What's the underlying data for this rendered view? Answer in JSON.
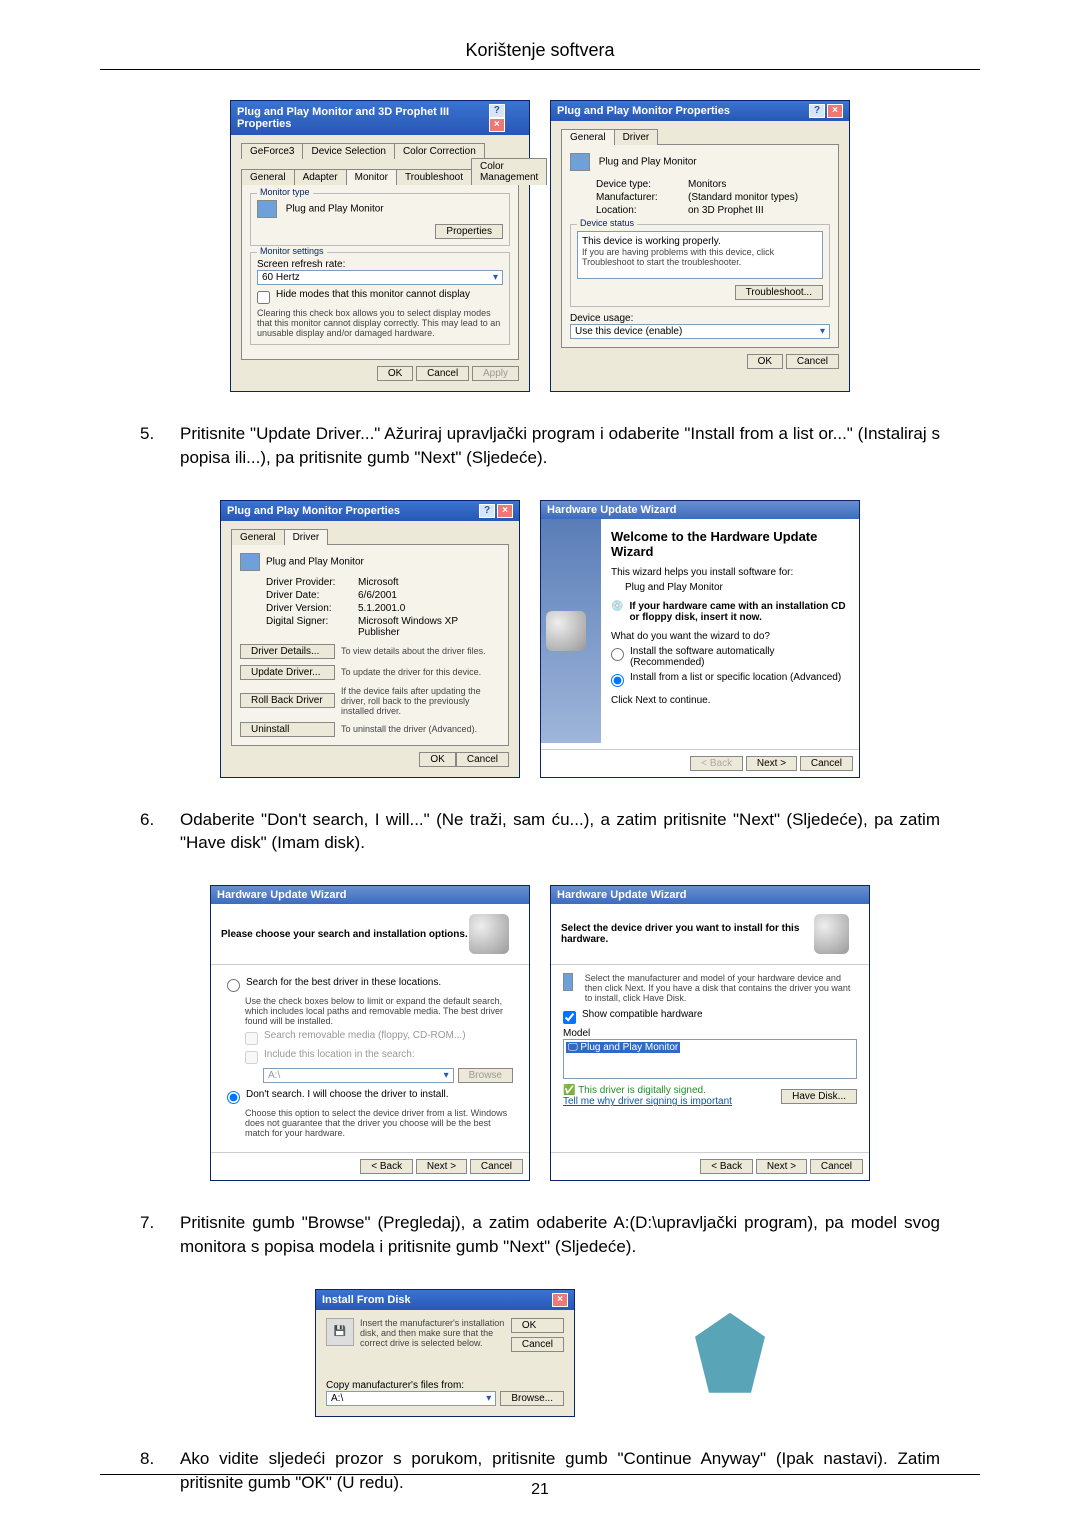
{
  "header_title": "Korištenje softvera",
  "page_number": "21",
  "step5": "Pritisnite \"Update Driver...\" Ažuriraj upravljački program i odaberite \"Install from a list or...\" (Instaliraj s popisa ili...), pa pritisnite gumb \"Next\" (Sljedeće).",
  "step6": "Odaberite \"Don't search, I will...\" (Ne traži, sam ću...), a zatim pritisnite \"Next\" (Sljedeće), pa zatim \"Have disk\" (Imam disk).",
  "step7": "Pritisnite gumb \"Browse\" (Pregledaj), a zatim odaberite A:(D:\\upravljački program), pa model svog monitora s popisa modela i pritisnite gumb \"Next\" (Sljedeće).",
  "step8": "Ako vidite sljedeći prozor s porukom, pritisnite gumb \"Continue Anyway\" (Ipak nastavi). Zatim pritisnite gumb \"OK\" (U redu).",
  "dlg1": {
    "title": "Plug and Play Monitor and 3D Prophet III Properties",
    "tabs": [
      "GeForce3",
      "Device Selection",
      "Color Correction",
      "General",
      "Adapter",
      "Monitor",
      "Troubleshoot",
      "Color Management"
    ],
    "montype_label": "Monitor type",
    "montype_value": "Plug and Play Monitor",
    "properties_btn": "Properties",
    "monset_label": "Monitor settings",
    "refresh_label": "Screen refresh rate:",
    "refresh_value": "60 Hertz",
    "hide_chk": "Hide modes that this monitor cannot display",
    "hide_note": "Clearing this check box allows you to select display modes that this monitor cannot display correctly. This may lead to an unusable display and/or damaged hardware.",
    "ok": "OK",
    "cancel": "Cancel",
    "apply": "Apply"
  },
  "dlg2": {
    "title": "Plug and Play Monitor Properties",
    "tabs": [
      "General",
      "Driver"
    ],
    "name": "Plug and Play Monitor",
    "dev_type_l": "Device type:",
    "dev_type_v": "Monitors",
    "manu_l": "Manufacturer:",
    "manu_v": "(Standard monitor types)",
    "loc_l": "Location:",
    "loc_v": "on 3D Prophet III",
    "status_group": "Device status",
    "status_text": "This device is working properly.",
    "status_note": "If you are having problems with this device, click Troubleshoot to start the troubleshooter.",
    "trouble_btn": "Troubleshoot...",
    "usage_l": "Device usage:",
    "usage_v": "Use this device (enable)",
    "ok": "OK",
    "cancel": "Cancel"
  },
  "dlg3": {
    "title": "Plug and Play Monitor Properties",
    "tabs": [
      "General",
      "Driver"
    ],
    "name": "Plug and Play Monitor",
    "prov_l": "Driver Provider:",
    "prov_v": "Microsoft",
    "date_l": "Driver Date:",
    "date_v": "6/6/2001",
    "ver_l": "Driver Version:",
    "ver_v": "5.1.2001.0",
    "sign_l": "Digital Signer:",
    "sign_v": "Microsoft Windows XP Publisher",
    "det_btn": "Driver Details...",
    "det_note": "To view details about the driver files.",
    "upd_btn": "Update Driver...",
    "upd_note": "To update the driver for this device.",
    "roll_btn": "Roll Back Driver",
    "roll_note": "If the device fails after updating the driver, roll back to the previously installed driver.",
    "unin_btn": "Uninstall",
    "unin_note": "To uninstall the driver (Advanced).",
    "ok": "OK",
    "cancel": "Cancel"
  },
  "dlg4": {
    "title": "Hardware Update Wizard",
    "welcome": "Welcome to the Hardware Update Wizard",
    "intro": "This wizard helps you install software for:",
    "device": "Plug and Play Monitor",
    "cd_note": "If your hardware came with an installation CD or floppy disk, insert it now.",
    "q": "What do you want the wizard to do?",
    "opt1": "Install the software automatically (Recommended)",
    "opt2": "Install from a list or specific location (Advanced)",
    "cont": "Click Next to continue.",
    "back": "< Back",
    "next": "Next >",
    "cancel": "Cancel"
  },
  "dlg5": {
    "title": "Hardware Update Wizard",
    "header": "Please choose your search and installation options.",
    "opt1": "Search for the best driver in these locations.",
    "opt1_note": "Use the check boxes below to limit or expand the default search, which includes local paths and removable media. The best driver found will be installed.",
    "chk1": "Search removable media (floppy, CD-ROM...)",
    "chk2": "Include this location in the search:",
    "loc": "A:\\",
    "browse": "Browse",
    "opt2": "Don't search. I will choose the driver to install.",
    "opt2_note": "Choose this option to select the device driver from a list. Windows does not guarantee that the driver you choose will be the best match for your hardware.",
    "back": "< Back",
    "next": "Next >",
    "cancel": "Cancel"
  },
  "dlg6": {
    "title": "Hardware Update Wizard",
    "header": "Select the device driver you want to install for this hardware.",
    "note": "Select the manufacturer and model of your hardware device and then click Next. If you have a disk that contains the driver you want to install, click Have Disk.",
    "show_chk": "Show compatible hardware",
    "model_l": "Model",
    "model_v": "Plug and Play Monitor",
    "signed": "This driver is digitally signed.",
    "tell": "Tell me why driver signing is important",
    "have": "Have Disk...",
    "back": "< Back",
    "next": "Next >",
    "cancel": "Cancel"
  },
  "dlg7": {
    "title": "Install From Disk",
    "msg": "Insert the manufacturer's installation disk, and then make sure that the correct drive is selected below.",
    "copy_l": "Copy manufacturer's files from:",
    "path": "A:\\",
    "ok": "OK",
    "cancel": "Cancel",
    "browse": "Browse..."
  }
}
